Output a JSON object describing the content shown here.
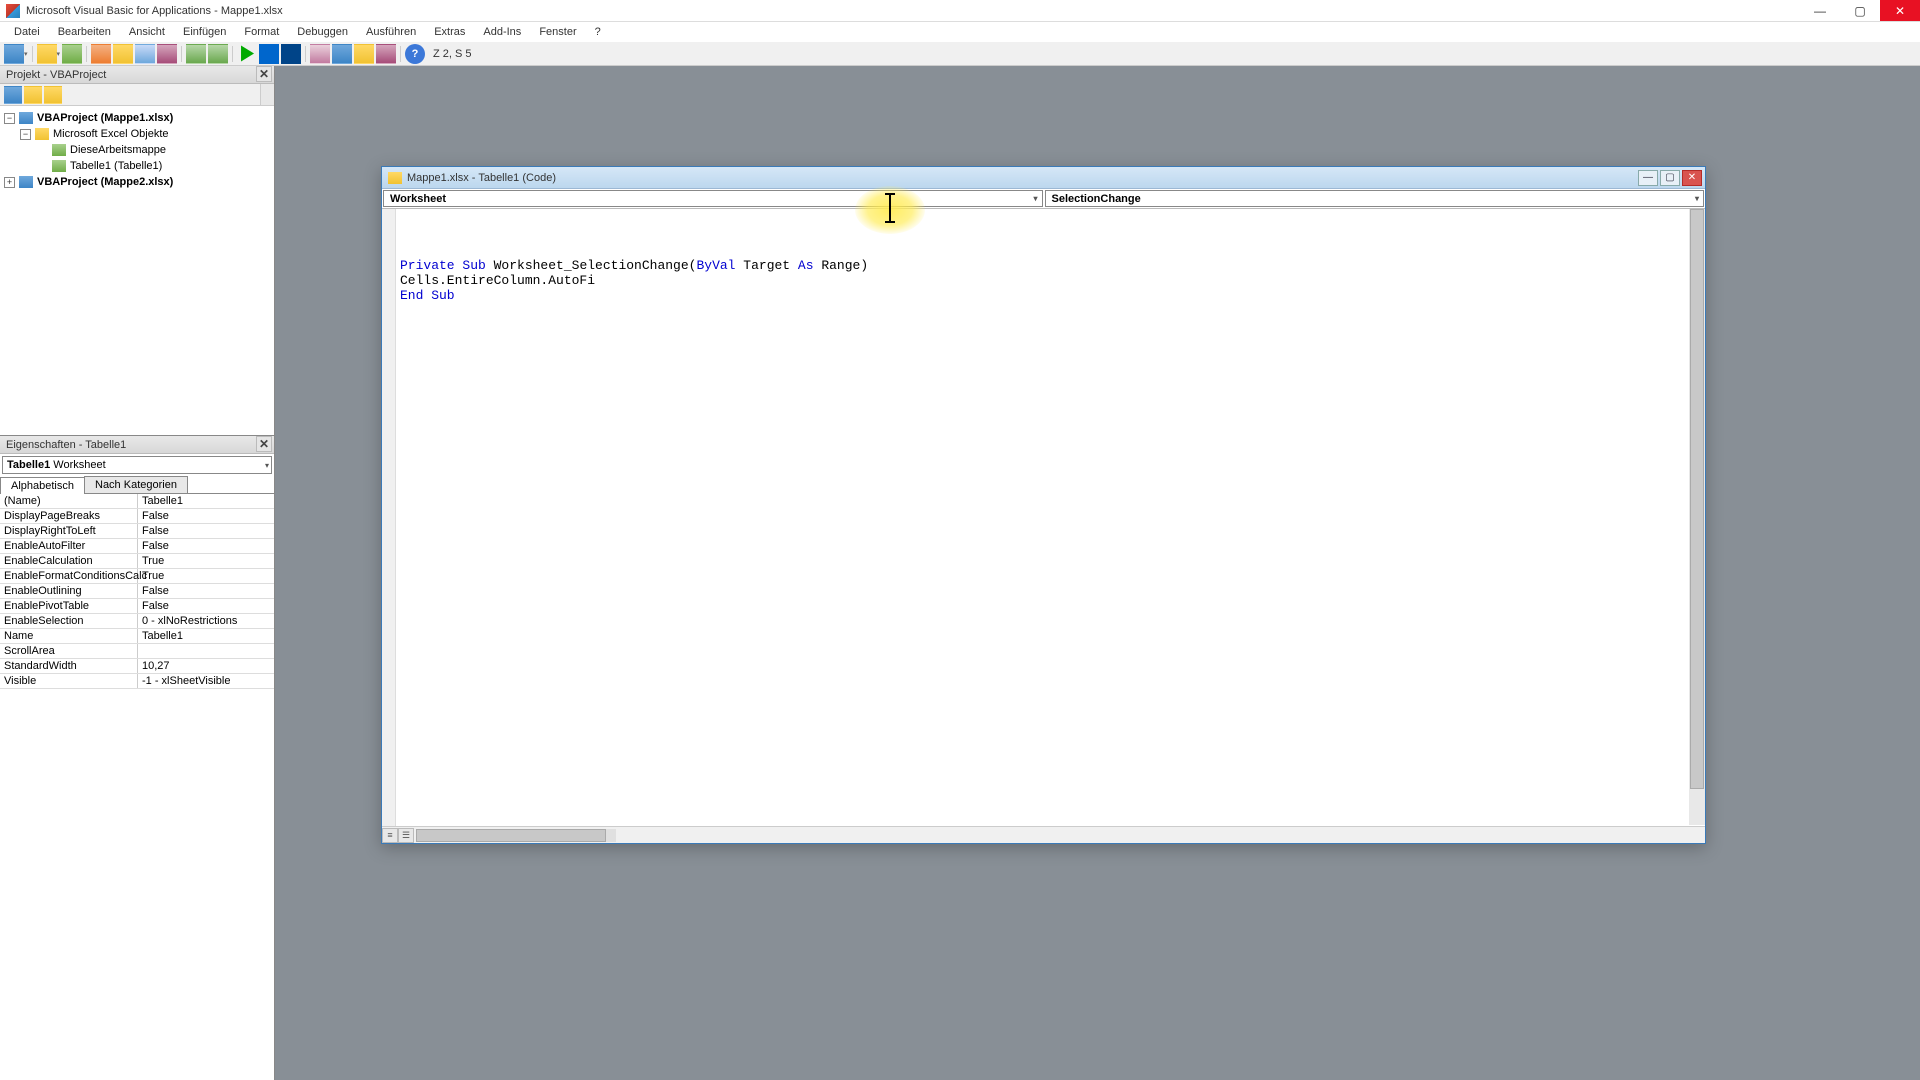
{
  "titlebar": {
    "title": "Microsoft Visual Basic for Applications - Mappe1.xlsx"
  },
  "menu": [
    "Datei",
    "Bearbeiten",
    "Ansicht",
    "Einfügen",
    "Format",
    "Debuggen",
    "Ausführen",
    "Extras",
    "Add-Ins",
    "Fenster",
    "?"
  ],
  "toolbar": {
    "position": "Z 2, S 5"
  },
  "project_panel": {
    "title": "Projekt - VBAProject",
    "tree": {
      "p1": "VBAProject (Mappe1.xlsx)",
      "p1_folder": "Microsoft Excel Objekte",
      "p1_item1": "DieseArbeitsmappe",
      "p1_item2": "Tabelle1 (Tabelle1)",
      "p2": "VBAProject (Mappe2.xlsx)"
    }
  },
  "props_panel": {
    "title": "Eigenschaften - Tabelle1",
    "object_name": "Tabelle1",
    "object_type": "Worksheet",
    "tab_alpha": "Alphabetisch",
    "tab_cat": "Nach Kategorien",
    "rows": [
      {
        "n": "(Name)",
        "v": "Tabelle1"
      },
      {
        "n": "DisplayPageBreaks",
        "v": "False"
      },
      {
        "n": "DisplayRightToLeft",
        "v": "False"
      },
      {
        "n": "EnableAutoFilter",
        "v": "False"
      },
      {
        "n": "EnableCalculation",
        "v": "True"
      },
      {
        "n": "EnableFormatConditionsCalc",
        "v": "True"
      },
      {
        "n": "EnableOutlining",
        "v": "False"
      },
      {
        "n": "EnablePivotTable",
        "v": "False"
      },
      {
        "n": "EnableSelection",
        "v": "0 - xlNoRestrictions"
      },
      {
        "n": "Name",
        "v": "Tabelle1"
      },
      {
        "n": "ScrollArea",
        "v": ""
      },
      {
        "n": "StandardWidth",
        "v": "10,27"
      },
      {
        "n": "Visible",
        "v": "-1 - xlSheetVisible"
      }
    ]
  },
  "code_window": {
    "title": "Mappe1.xlsx - Tabelle1 (Code)",
    "dd_left": "Worksheet",
    "dd_right": "SelectionChange",
    "line1_a": "Private Sub",
    "line1_b": " Worksheet_SelectionChange(",
    "line1_c": "ByVal",
    "line1_d": " Target ",
    "line1_e": "As",
    "line1_f": " Range)",
    "line2": "Cells.EntireColumn.AutoFi",
    "line3": "End Sub"
  }
}
